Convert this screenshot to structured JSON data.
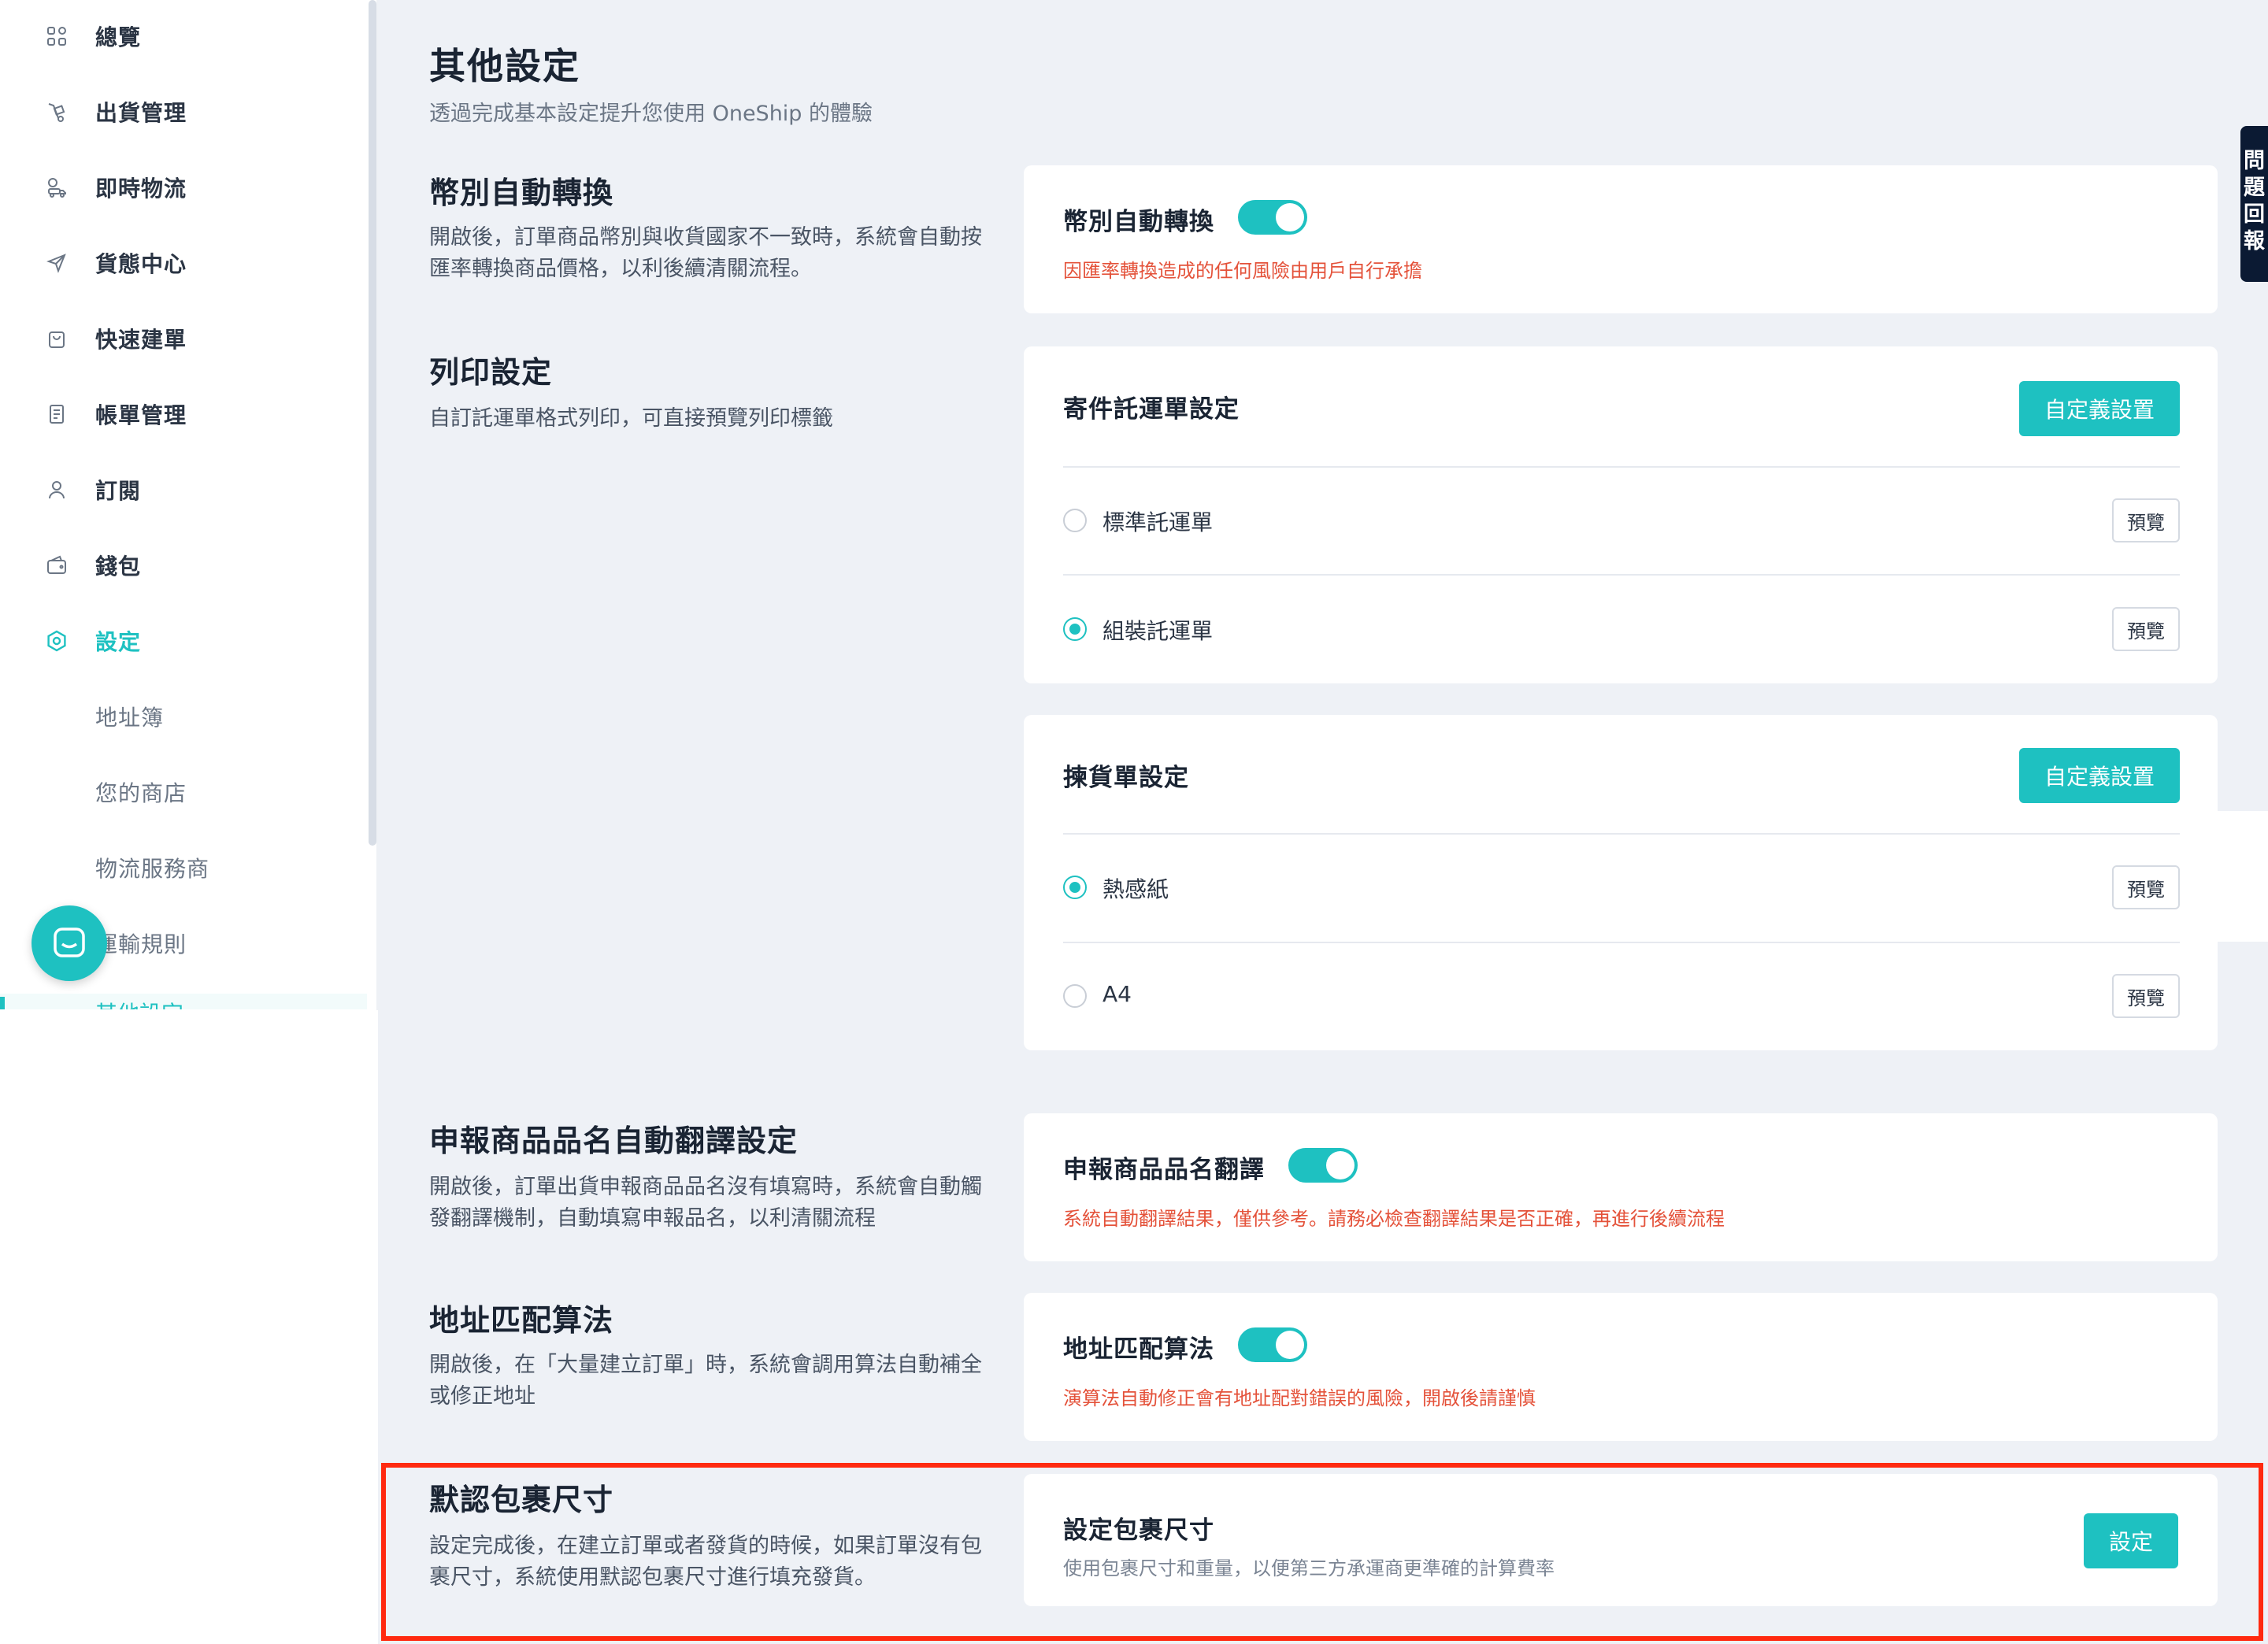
{
  "sidebar": {
    "items": [
      {
        "label": "總覽",
        "icon": "grid-icon"
      },
      {
        "label": "出貨管理",
        "icon": "shipping-icon"
      },
      {
        "label": "即時物流",
        "icon": "delivery-icon"
      },
      {
        "label": "貨態中心",
        "icon": "send-icon"
      },
      {
        "label": "快速建單",
        "icon": "bag-icon"
      },
      {
        "label": "帳單管理",
        "icon": "bill-icon"
      },
      {
        "label": "訂閱",
        "icon": "user-icon"
      },
      {
        "label": "錢包",
        "icon": "wallet-icon"
      },
      {
        "label": "設定",
        "icon": "settings-icon"
      }
    ],
    "sub_items": [
      "地址簿",
      "您的商店",
      "物流服務商",
      "運輸規則"
    ],
    "partial_item": "其他設定"
  },
  "page": {
    "title": "其他設定",
    "subtitle": "透過完成基本設定提升您使用 OneShip 的體驗"
  },
  "sections": {
    "currency": {
      "title": "幣別自動轉換",
      "desc": "開啟後，訂單商品幣別與收貨國家不一致時，系統會自動按匯率轉換商品價格，以利後續清關流程。",
      "card_title": "幣別自動轉換",
      "warning": "因匯率轉換造成的任何風險由用戶自行承擔",
      "enabled": true
    },
    "print": {
      "title": "列印設定",
      "desc": "自訂託運單格式列印，可直接預覽列印標籤",
      "waybill": {
        "title": "寄件託運單設定",
        "button": "自定義設置",
        "options": [
          "標準託運單",
          "組裝託運單"
        ],
        "selected": "組裝託運單",
        "preview": "預覽"
      },
      "picking": {
        "title": "揀貨單設定",
        "button": "自定義設置",
        "options": [
          "熱感紙",
          "A4"
        ],
        "selected": "熱感紙",
        "preview": "預覽"
      }
    },
    "translate": {
      "title": "申報商品品名自動翻譯設定",
      "desc": "開啟後，訂單出貨申報商品品名沒有填寫時，系統會自動觸發翻譯機制，自動填寫申報品名，以利清關流程",
      "card_title": "申報商品品名翻譯",
      "warning": "系統自動翻譯結果，僅供參考。請務必檢查翻譯結果是否正確，再進行後續流程",
      "enabled": true
    },
    "address": {
      "title": "地址匹配算法",
      "desc": "開啟後，在「大量建立訂單」時，系統會調用算法自動補全或修正地址",
      "card_title": "地址匹配算法",
      "warning": "演算法自動修正會有地址配對錯誤的風險，開啟後請謹慎",
      "enabled": true
    },
    "parcel": {
      "title": "默認包裹尺寸",
      "desc": "設定完成後，在建立訂單或者發貨的時候，如果訂單沒有包裹尺寸，系統使用默認包裹尺寸進行填充發貨。",
      "card_title": "設定包裹尺寸",
      "card_desc": "使用包裹尺寸和重量，以便第三方承運商更準確的計算費率",
      "button": "設定"
    }
  },
  "feedback_tab": "問題回報",
  "colors": {
    "accent": "#1ec1c1",
    "warning": "#e4523a",
    "highlight": "#ff2a10",
    "feedback_bg": "#0b1a33"
  }
}
